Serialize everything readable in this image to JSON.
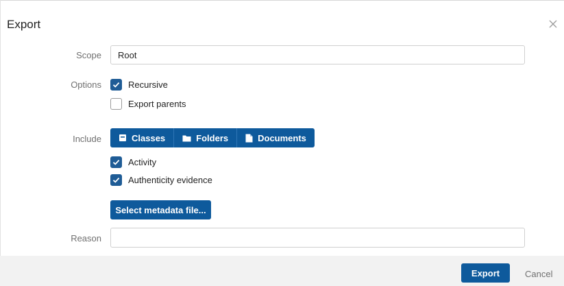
{
  "dialog": {
    "title": "Export"
  },
  "form": {
    "scope_label": "Scope",
    "scope_value": "Root",
    "options_label": "Options",
    "options": [
      {
        "label": "Recursive",
        "checked": true
      },
      {
        "label": "Export parents",
        "checked": false
      }
    ],
    "include_label": "Include",
    "include_buttons": [
      {
        "label": "Classes",
        "icon": "class-icon"
      },
      {
        "label": "Folders",
        "icon": "folder-icon"
      },
      {
        "label": "Documents",
        "icon": "document-icon"
      }
    ],
    "include_checks": [
      {
        "label": "Activity",
        "checked": true
      },
      {
        "label": "Authenticity evidence",
        "checked": true
      }
    ],
    "metadata_button": "Select metadata file...",
    "reason_label": "Reason",
    "reason_value": ""
  },
  "footer": {
    "export_label": "Export",
    "cancel_label": "Cancel"
  },
  "colors": {
    "accent": "#0e5a9c",
    "checkbox": "#1f5c96",
    "footer_bg": "#f2f2f2"
  }
}
